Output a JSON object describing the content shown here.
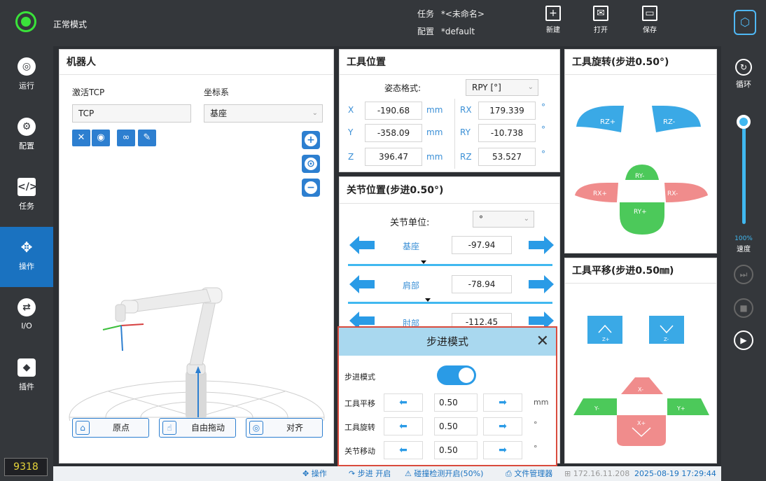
{
  "topbar": {
    "mode": "正常模式",
    "job_label": "任务",
    "job_value": "*<未命名>",
    "config_label": "配置",
    "config_value": "*default",
    "new_label": "新建",
    "open_label": "打开",
    "save_label": "保存"
  },
  "leftnav": {
    "items": [
      {
        "label": "运行",
        "icon": "play-circle-icon"
      },
      {
        "label": "配置",
        "icon": "gear-icon"
      },
      {
        "label": "任务",
        "icon": "code-window-icon"
      },
      {
        "label": "操作",
        "icon": "move-arrows-icon"
      },
      {
        "label": "I/O",
        "icon": "io-arrows-icon"
      },
      {
        "label": "插件",
        "icon": "cube-icon"
      }
    ],
    "counter": "9318"
  },
  "rightnav": {
    "loop_label": "循环",
    "speed_pct": "100%",
    "speed_label": "速度",
    "speed_value": 1.0
  },
  "robot": {
    "title": "机器人",
    "tcp_label": "激活TCP",
    "tcp_value": "TCP",
    "coord_label": "坐标系",
    "coord_value": "基座",
    "home_label": "原点",
    "freedrive_label": "自由拖动",
    "align_label": "对齐"
  },
  "tool_position": {
    "title": "工具位置",
    "format_label": "姿态格式:",
    "format_value": "RPY [°]",
    "x": {
      "label": "X",
      "value": "-190.68",
      "unit": "mm"
    },
    "y": {
      "label": "Y",
      "value": "-358.09",
      "unit": "mm"
    },
    "z": {
      "label": "Z",
      "value": "396.47",
      "unit": "mm"
    },
    "rx": {
      "label": "RX",
      "value": "179.339",
      "unit": "°"
    },
    "ry": {
      "label": "RY",
      "value": "-10.738",
      "unit": "°"
    },
    "rz": {
      "label": "RZ",
      "value": "53.527",
      "unit": "°"
    }
  },
  "joint_position": {
    "title": "关节位置(步进0.50°)",
    "unit_label": "关节单位:",
    "unit_value": "°",
    "joints": [
      {
        "name": "基座",
        "value": "-97.94",
        "slider": 0.37
      },
      {
        "name": "肩部",
        "value": "-78.94",
        "slider": 0.39
      },
      {
        "name": "肘部",
        "value": "-112.45",
        "slider": 0.3
      }
    ]
  },
  "tool_rotation": {
    "title": "工具旋转(步进0.50°)",
    "rz_plus": "RZ+",
    "rz_minus": "RZ-",
    "rx_plus": "RX+",
    "rx_minus": "RX-",
    "ry_plus": "RY+",
    "ry_minus": "RY-"
  },
  "tool_translation": {
    "title": "工具平移(步进0.50㎜)",
    "z_plus": "Z+",
    "z_minus": "Z-",
    "x_plus": "X+",
    "x_minus": "X-",
    "y_plus": "Y+",
    "y_minus": "Y-"
  },
  "step_dialog": {
    "title": "步进模式",
    "step_mode_label": "步进模式",
    "translate_label": "工具平移",
    "translate_value": "0.50",
    "translate_unit": "mm",
    "rotate_label": "工具旋转",
    "rotate_value": "0.50",
    "rotate_unit": "°",
    "joint_label": "关节移动",
    "joint_value": "0.50",
    "joint_unit": "°",
    "enabled": true
  },
  "statusbar": {
    "operate": "操作",
    "step_on": "步进 开启",
    "collision": "碰撞检测开启(50%)",
    "file_manager": "文件管理器",
    "ip": "172.16.11.208",
    "datetime": "2025-08-19 17:29:44"
  },
  "colors": {
    "accent": "#2d7fd0",
    "active_nav": "#1a72c0",
    "status_green": "#3ae23a",
    "rot_blue": "#3aa9e6",
    "rot_red": "#f08c8c",
    "rot_green": "#4cc95a",
    "dialog_border": "#d94b3d"
  }
}
